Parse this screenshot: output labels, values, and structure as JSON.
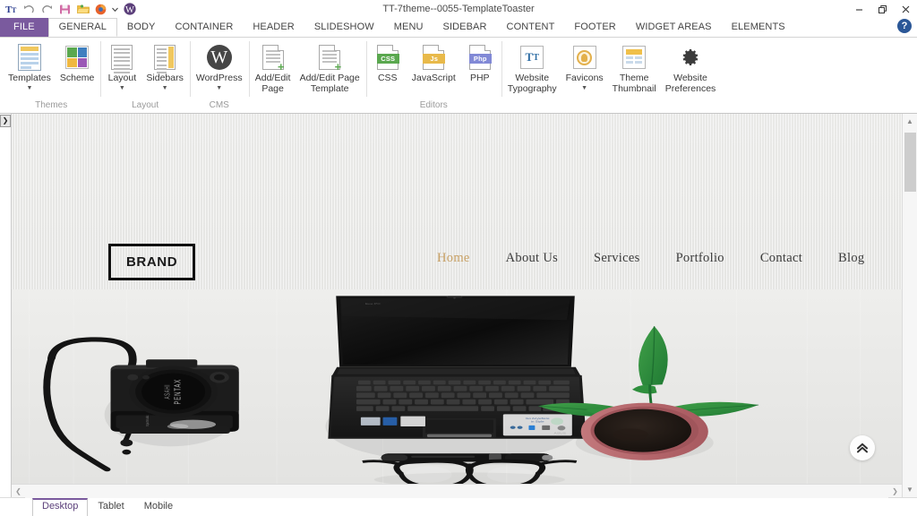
{
  "window": {
    "title": "TT-7theme--0055-TemplateToaster",
    "minimize_label": "Minimize",
    "restore_label": "Restore",
    "close_label": "Close",
    "help_label": "?"
  },
  "quick_access": [
    {
      "name": "app-logo-icon",
      "label": "TT"
    },
    {
      "name": "undo-icon",
      "label": "Undo"
    },
    {
      "name": "redo-icon",
      "label": "Redo"
    },
    {
      "name": "save-icon",
      "label": "Save"
    },
    {
      "name": "open-icon",
      "label": "Open"
    },
    {
      "name": "preview-browser-icon",
      "label": "Preview in Browser"
    },
    {
      "name": "preview-dropdown-icon",
      "label": "Preview Options"
    },
    {
      "name": "wordpress-icon",
      "label": "WordPress"
    }
  ],
  "ribbon": {
    "tabs": [
      {
        "label": "FILE",
        "type": "file"
      },
      {
        "label": "GENERAL",
        "type": "active"
      },
      {
        "label": "BODY",
        "type": "normal"
      },
      {
        "label": "CONTAINER",
        "type": "normal"
      },
      {
        "label": "HEADER",
        "type": "normal"
      },
      {
        "label": "SLIDESHOW",
        "type": "normal"
      },
      {
        "label": "MENU",
        "type": "normal"
      },
      {
        "label": "SIDEBAR",
        "type": "normal"
      },
      {
        "label": "CONTENT",
        "type": "normal"
      },
      {
        "label": "FOOTER",
        "type": "normal"
      },
      {
        "label": "WIDGET AREAS",
        "type": "normal"
      },
      {
        "label": "ELEMENTS",
        "type": "normal"
      }
    ],
    "groups": [
      {
        "name": "themes",
        "label": "Themes",
        "buttons": [
          {
            "name": "templates-button",
            "label": "Templates",
            "icon": "template-icon",
            "caret": true
          },
          {
            "name": "scheme-button",
            "label": "Scheme",
            "icon": "scheme-icon",
            "caret": false
          }
        ]
      },
      {
        "name": "layout",
        "label": "Layout",
        "buttons": [
          {
            "name": "layout-button",
            "label": "Layout",
            "icon": "layout-icon",
            "caret": true
          },
          {
            "name": "sidebars-button",
            "label": "Sidebars",
            "icon": "sidebars-icon",
            "caret": true
          }
        ]
      },
      {
        "name": "cms",
        "label": "CMS",
        "buttons": [
          {
            "name": "wordpress-button",
            "label": "WordPress",
            "icon": "wordpress-icon",
            "caret": true
          }
        ]
      },
      {
        "name": "pages",
        "label": "",
        "buttons": [
          {
            "name": "add-edit-page-button",
            "label": "Add/Edit\nPage",
            "icon": "page-add-icon",
            "caret": false
          },
          {
            "name": "add-edit-page-template-button",
            "label": "Add/Edit Page\nTemplate",
            "icon": "page-template-add-icon",
            "caret": false
          }
        ]
      },
      {
        "name": "editors",
        "label": "Editors",
        "buttons": [
          {
            "name": "css-editor-button",
            "label": "CSS",
            "icon": "css-file-icon",
            "badge": "CSS",
            "badge_color": "#5aa84f",
            "caret": false
          },
          {
            "name": "javascript-editor-button",
            "label": "JavaScript",
            "icon": "js-file-icon",
            "badge": "Js",
            "badge_color": "#e8b94a",
            "caret": false
          },
          {
            "name": "php-editor-button",
            "label": "PHP",
            "icon": "php-file-icon",
            "badge": "Php",
            "badge_color": "#8189d6",
            "caret": false
          }
        ]
      },
      {
        "name": "website",
        "label": "",
        "buttons": [
          {
            "name": "website-typography-button",
            "label": "Website\nTypography",
            "icon": "typography-icon",
            "caret": false
          },
          {
            "name": "favicons-button",
            "label": "Favicons",
            "icon": "favicon-icon",
            "caret": true
          },
          {
            "name": "theme-thumbnail-button",
            "label": "Theme\nThumbnail",
            "icon": "thumbnail-icon",
            "caret": false
          },
          {
            "name": "website-preferences-button",
            "label": "Website\nPreferences",
            "icon": "gear-icon",
            "caret": false
          }
        ]
      }
    ]
  },
  "preview": {
    "brand": "BRAND",
    "nav": [
      {
        "label": "Home",
        "active": true
      },
      {
        "label": "About Us",
        "active": false
      },
      {
        "label": "Services",
        "active": false
      },
      {
        "label": "Portfolio",
        "active": false
      },
      {
        "label": "Contact",
        "active": false
      },
      {
        "label": "Blog",
        "active": false
      }
    ],
    "scroll_top_label": "Scroll to top",
    "hero_alt": "Flat lay desk photo with laptop, Pentax camera, pen, eyeglasses and potted plant",
    "accent_color": "#c8a165"
  },
  "sidebar": {
    "expand_label": "Expand panel"
  },
  "device_tabs": [
    {
      "label": "Desktop",
      "active": true
    },
    {
      "label": "Tablet",
      "active": false
    },
    {
      "label": "Mobile",
      "active": false
    }
  ]
}
